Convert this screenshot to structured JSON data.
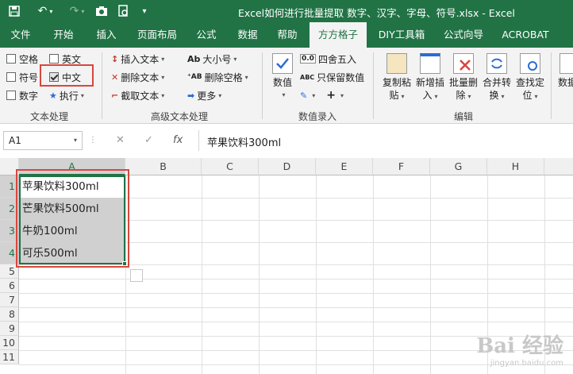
{
  "window": {
    "title": "Excel如何进行批量提取 数字、汉字、字母、符号.xlsx  -  Excel",
    "quick_access": [
      "save-icon",
      "undo-icon",
      "redo-icon",
      "camera-icon",
      "print-preview-icon",
      "customize-icon"
    ]
  },
  "tabs": [
    "文件",
    "开始",
    "插入",
    "页面布局",
    "公式",
    "数据",
    "帮助",
    "方方格子",
    "DIY工具箱",
    "公式向导",
    "ACROBAT"
  ],
  "active_tab": "方方格子",
  "ribbon": {
    "text_group": {
      "label": "文本处理",
      "items": [
        {
          "label": "空格",
          "checked": false
        },
        {
          "label": "英文",
          "checked": false
        },
        {
          "label": "符号",
          "checked": false
        },
        {
          "label": "中文",
          "checked": true
        },
        {
          "label": "数字",
          "checked": false
        },
        {
          "label": "执行",
          "checked": false
        }
      ]
    },
    "advanced_group": {
      "label": "高级文本处理",
      "insert_text": "插入文本",
      "delete_text": "删除文本",
      "cut_text": "截取文本",
      "case": "大小号",
      "delete_space": "删除空格",
      "more": "更多"
    },
    "number_group": {
      "label": "数值录入",
      "big_button": "数值",
      "round": "四舍五入",
      "keep_values": "只保留数值"
    },
    "edit_group": {
      "label": "编辑",
      "buttons": [
        {
          "line1": "复制粘",
          "line2": "贴"
        },
        {
          "line1": "新增插",
          "line2": "入"
        },
        {
          "line1": "批量删",
          "line2": "除"
        },
        {
          "line1": "合并转",
          "line2": "换"
        },
        {
          "line1": "查找定",
          "line2": "位"
        }
      ],
      "overflow": "数据"
    }
  },
  "formula_bar": {
    "name_box": "A1",
    "fx": "fx",
    "content": "苹果饮料300ml"
  },
  "sheet": {
    "columns": [
      "A",
      "B",
      "C",
      "D",
      "E",
      "F",
      "G",
      "H"
    ],
    "rows": [
      "1",
      "2",
      "3",
      "4",
      "5",
      "6",
      "7",
      "8",
      "9",
      "10",
      "11"
    ],
    "cells_A": [
      "苹果饮料300ml",
      "芒果饮料500ml",
      "牛奶100ml",
      "可乐500ml"
    ]
  },
  "watermark": {
    "text": "Bai 经验",
    "sub": "jingyan.baidu.com"
  }
}
